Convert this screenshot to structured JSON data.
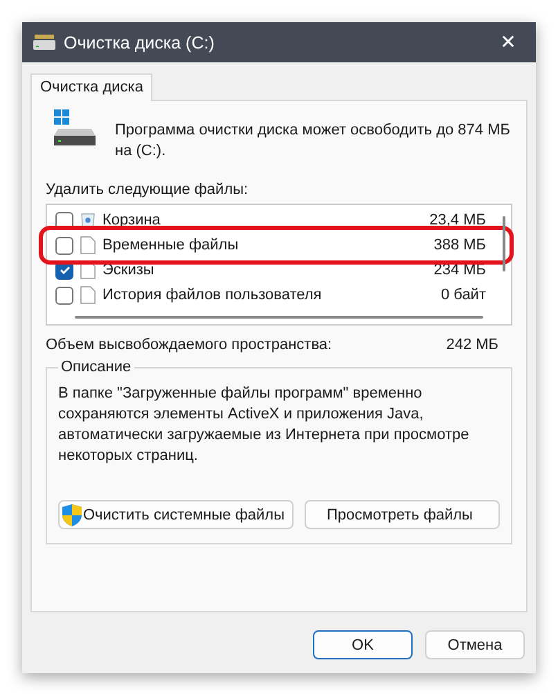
{
  "window": {
    "title": "Очистка диска  (C:)",
    "close": "✕"
  },
  "tabs": [
    {
      "label": "Очистка диска",
      "selected": true
    }
  ],
  "summary": "Программа очистки диска может освободить до 874 МБ на  (C:).",
  "files_label": "Удалить следующие файлы:",
  "files": [
    {
      "name": "Корзина",
      "size": "23,4 МБ",
      "checked": false,
      "kind": "recycle",
      "highlighted": false
    },
    {
      "name": "Временные файлы",
      "size": "388 МБ",
      "checked": false,
      "kind": "file",
      "highlighted": true
    },
    {
      "name": "Эскизы",
      "size": "234 МБ",
      "checked": true,
      "kind": "file",
      "highlighted": false
    },
    {
      "name": "История файлов пользователя",
      "size": "0 байт",
      "checked": false,
      "kind": "file",
      "highlighted": false
    }
  ],
  "freed_label": "Объем высвобождаемого пространства:",
  "freed_value": "242 МБ",
  "description": {
    "title": "Описание",
    "text": "В папке \"Загруженные файлы программ\" временно сохраняются элементы ActiveX и приложения Java, автоматически загружаемые из Интернета при просмотре некоторых страниц."
  },
  "actions": [
    {
      "label": "Очистить системные файлы",
      "kind": "shield"
    },
    {
      "label": "Просмотреть файлы",
      "kind": "plain"
    }
  ],
  "buttons": [
    {
      "label": "OK",
      "kind": "default"
    },
    {
      "label": "Отмена",
      "kind": "normal"
    }
  ]
}
